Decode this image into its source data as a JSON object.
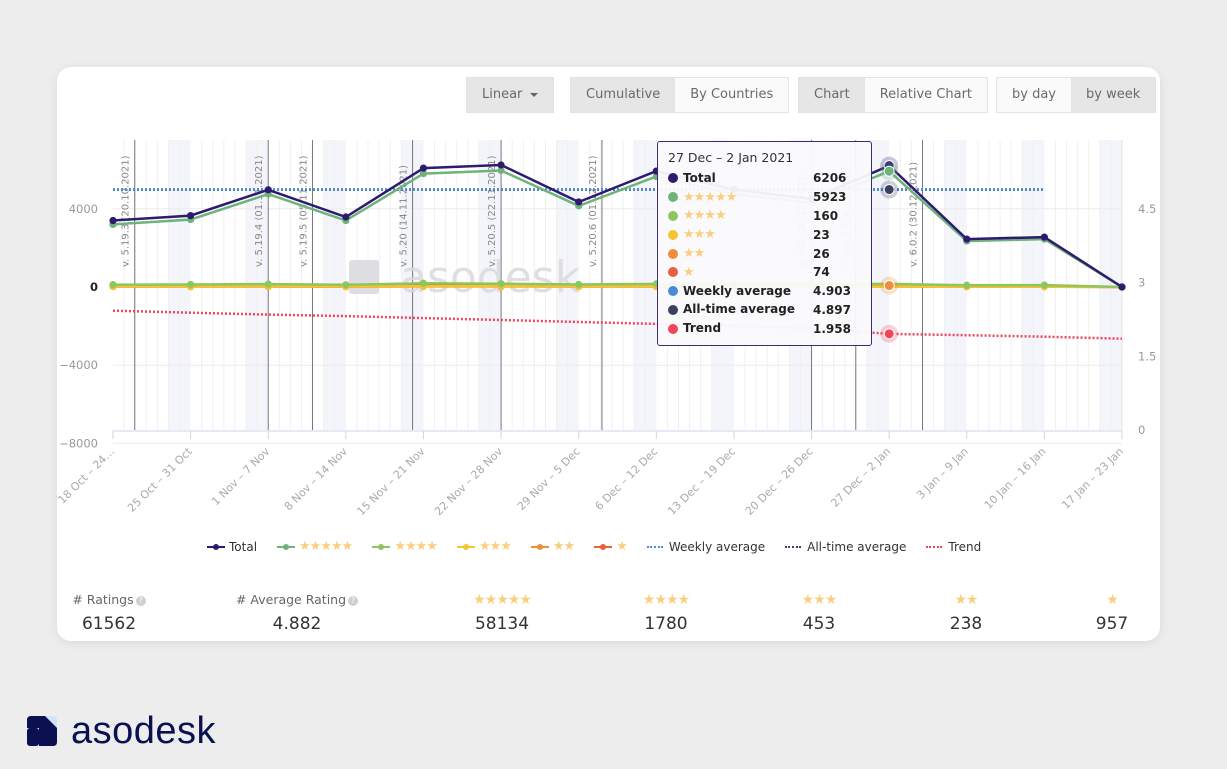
{
  "toolbar": {
    "scale": {
      "label": "Linear"
    },
    "mode_tabs": [
      {
        "label": "Cumulative",
        "active": true
      },
      {
        "label": "By Countries",
        "active": false
      }
    ],
    "chart_tabs": [
      {
        "label": "Chart",
        "active": true
      },
      {
        "label": "Relative Chart",
        "active": false
      }
    ],
    "period_tabs": [
      {
        "label": "by day",
        "active": false
      },
      {
        "label": "by week",
        "active": true
      }
    ]
  },
  "watermark": "asodesk",
  "tooltip": {
    "title": "27 Dec – 2 Jan 2021",
    "rows": [
      {
        "name": "Total",
        "stars": "",
        "value": "6206",
        "color": "#2e1a6e"
      },
      {
        "name": "",
        "stars": "★★★★★",
        "value": "5923",
        "color": "#6db37a"
      },
      {
        "name": "",
        "stars": "★★★★",
        "value": "160",
        "color": "#8cc65c"
      },
      {
        "name": "",
        "stars": "★★★",
        "value": "23",
        "color": "#f4c431"
      },
      {
        "name": "",
        "stars": "★★",
        "value": "26",
        "color": "#ef8e36"
      },
      {
        "name": "",
        "stars": "★",
        "value": "74",
        "color": "#e5603d"
      },
      {
        "name": "Weekly average",
        "stars": "",
        "value": "4.903",
        "color": "#4a8bd6"
      },
      {
        "name": "All-time average",
        "stars": "",
        "value": "4.897",
        "color": "#3b4260"
      },
      {
        "name": "Trend",
        "stars": "",
        "value": "1.958",
        "color": "#f2455a"
      }
    ]
  },
  "legend": [
    {
      "name": "Total",
      "stars": "",
      "type": "line",
      "color": "#2e1a6e"
    },
    {
      "name": "",
      "stars": "★★★★★",
      "type": "line",
      "color": "#6db37a"
    },
    {
      "name": "",
      "stars": "★★★★",
      "type": "line",
      "color": "#8cc65c"
    },
    {
      "name": "",
      "stars": "★★★",
      "type": "line",
      "color": "#f4c431"
    },
    {
      "name": "",
      "stars": "★★",
      "type": "line",
      "color": "#ef8e36"
    },
    {
      "name": "",
      "stars": "★",
      "type": "line",
      "color": "#e5603d"
    },
    {
      "name": "Weekly average",
      "stars": "",
      "type": "dotted",
      "color": "#4a8bd6"
    },
    {
      "name": "All-time average",
      "stars": "",
      "type": "dotted",
      "color": "#3b4260"
    },
    {
      "name": "Trend",
      "stars": "",
      "type": "dotted",
      "color": "#f2455a"
    }
  ],
  "stats": [
    {
      "label": "# Ratings",
      "stars": "",
      "info": true,
      "value": "61562"
    },
    {
      "label": "# Average Rating",
      "stars": "",
      "info": true,
      "value": "4.882"
    },
    {
      "label": "",
      "stars": "★★★★★",
      "info": false,
      "value": "58134"
    },
    {
      "label": "",
      "stars": "★★★★",
      "info": false,
      "value": "1780"
    },
    {
      "label": "",
      "stars": "★★★",
      "info": false,
      "value": "453"
    },
    {
      "label": "",
      "stars": "★★",
      "info": false,
      "value": "238"
    },
    {
      "label": "",
      "stars": "★",
      "info": false,
      "value": "957"
    }
  ],
  "brand": {
    "name": "asodesk"
  },
  "chart_data": {
    "type": "line",
    "title": "",
    "x": [
      "18 Oct – 24…",
      "25 Oct – 31 Oct",
      "1 Nov – 7 Nov",
      "8 Nov – 14 Nov",
      "15 Nov – 21 Nov",
      "22 Nov – 28 Nov",
      "29 Nov – 5 Dec",
      "6 Dec – 12 Dec",
      "13 Dec – 19 Dec",
      "20 Dec – 26 Dec",
      "27 Dec – 2 Jan",
      "3 Jan – 9 Jan",
      "10 Jan – 16 Jan",
      "17 Jan – 23 Jan"
    ],
    "left_axis": {
      "ticks": [
        "4000",
        "0",
        "−4000",
        "−8000"
      ],
      "tick_values": [
        4000,
        0,
        -4000,
        -8000
      ],
      "ylim": [
        -8000,
        7600
      ]
    },
    "right_axis": {
      "ticks": [
        "4.5",
        "3",
        "1.5",
        "0"
      ],
      "tick_values": [
        4.5,
        3,
        1.5,
        0
      ],
      "ylim": [
        0,
        6
      ]
    },
    "series": [
      {
        "name": "Total",
        "axis": "left",
        "color": "#2e1a6e",
        "style": "solid",
        "values": [
          3400,
          3650,
          4970,
          3580,
          6080,
          6240,
          4350,
          5930,
          4980,
          4500,
          6206,
          2450,
          2550,
          0
        ]
      },
      {
        "name": "5 stars",
        "axis": "left",
        "color": "#6db37a",
        "style": "solid",
        "values": [
          3200,
          3450,
          4750,
          3400,
          5800,
          5960,
          4150,
          5650,
          4750,
          4300,
          5923,
          2350,
          2450,
          0
        ]
      },
      {
        "name": "4 stars",
        "axis": "left",
        "color": "#8cc65c",
        "style": "solid",
        "values": [
          120,
          130,
          150,
          110,
          190,
          170,
          130,
          160,
          150,
          140,
          160,
          90,
          95,
          0
        ]
      },
      {
        "name": "3 stars",
        "axis": "left",
        "color": "#f4c431",
        "style": "solid",
        "values": [
          30,
          28,
          35,
          25,
          40,
          38,
          30,
          35,
          30,
          28,
          23,
          20,
          22,
          0
        ]
      },
      {
        "name": "2 stars",
        "axis": "left",
        "color": "#ef8e36",
        "style": "solid",
        "values": [
          20,
          18,
          22,
          15,
          25,
          24,
          18,
          22,
          20,
          18,
          26,
          12,
          14,
          0
        ]
      },
      {
        "name": "1 star",
        "axis": "left",
        "color": "#e5603d",
        "style": "solid",
        "values": [
          60,
          55,
          70,
          50,
          80,
          75,
          60,
          72,
          65,
          60,
          74,
          40,
          42,
          0
        ]
      },
      {
        "name": "Weekly average",
        "axis": "right",
        "color": "#4a8bd6",
        "style": "dotted",
        "values": [
          4.9,
          4.9,
          4.9,
          4.9,
          4.9,
          4.9,
          4.9,
          4.9,
          4.9,
          4.9,
          4.903,
          4.9,
          4.9,
          null
        ]
      },
      {
        "name": "All-time average",
        "axis": "right",
        "color": "#3b4260",
        "style": "dotted",
        "values": [
          4.897,
          4.897,
          4.897,
          4.897,
          4.897,
          4.897,
          4.897,
          4.897,
          4.897,
          4.897,
          4.897,
          4.897,
          4.897,
          null
        ]
      },
      {
        "name": "Trend",
        "axis": "right",
        "color": "#f2455a",
        "style": "dotted",
        "values": [
          2.43,
          2.39,
          2.35,
          2.32,
          2.28,
          2.24,
          2.2,
          2.16,
          2.12,
          2.07,
          1.958,
          1.93,
          1.9,
          1.86
        ]
      }
    ],
    "version_annotations": [
      {
        "label": "v. 5.19.3 (20.10.2021)",
        "at": 0.28
      },
      {
        "label": "v. 5.19.4 (01.11.2021)",
        "at": 2.0
      },
      {
        "label": "v. 5.19.5 (05.11.2021)",
        "at": 2.57
      },
      {
        "label": "v. 5.20 (14.11.2021)",
        "at": 3.86
      },
      {
        "label": "v. 5.20.5 (22.11.2021)",
        "at": 5.0
      },
      {
        "label": "v. 5.20.6 (01.12.2021)",
        "at": 6.3
      },
      {
        "label": "v. 6.0 (20.12.2021)",
        "at": 9.0
      },
      {
        "label": "v. 6.0.1 (24.12.2021)",
        "at": 9.57
      },
      {
        "label": "v. 6.0.2 (30.12.2021)",
        "at": 10.43
      }
    ],
    "highlighted_x": "27 Dec – 2 Jan",
    "grid": true,
    "legend_position": "bottom"
  }
}
